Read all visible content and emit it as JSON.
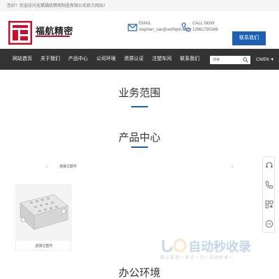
{
  "topbar": {
    "welcome": "您好！欢迎访问无锡福航精密制造有限公司官方网站！"
  },
  "header": {
    "logo_text": "福航精密",
    "email": {
      "label": "EMAIL",
      "value": "stephen_cao@wxfhpm.com"
    },
    "phone": {
      "label": "CALL NOW",
      "value": "13961785346"
    },
    "contact_button": "联系我们"
  },
  "nav": {
    "items": [
      "网站首页",
      "关于我们",
      "产品中心",
      "公司环境",
      "资质认证",
      "注塑车间",
      "联系我们"
    ],
    "search_placeholder": "搜索",
    "lang": "CN/EN ▼"
  },
  "sections": {
    "business": "业务范围",
    "products": "产品中心",
    "office": "办公环境"
  },
  "products": {
    "tab_label": "连接注塑件",
    "prev": "‹",
    "next": "›",
    "items": [
      {
        "name": "连接注塑件"
      }
    ]
  },
  "watermark": {
    "title": "自动秒收录",
    "subtitle": "数上链接一来访一次一自动收录一"
  },
  "colors": {
    "accent": "#1e5fb6",
    "nav_bg": "#333333",
    "brand_red": "#c8102e"
  }
}
